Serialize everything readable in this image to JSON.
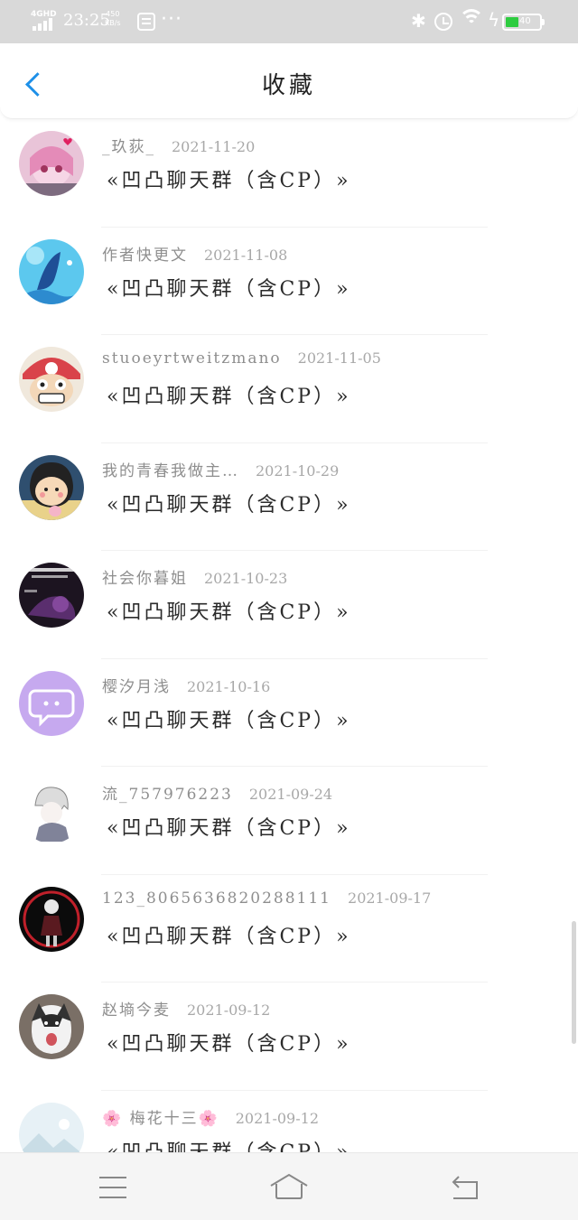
{
  "status_bar": {
    "network": "4GHD",
    "time": "23:25",
    "speed_value": "450",
    "speed_unit": "KB/s",
    "dots": "···",
    "bluetooth": "✱",
    "bolt": "ϟ",
    "battery_level": "40",
    "battery_color": "#2ecc40"
  },
  "header": {
    "back_icon": "chevron-left-icon",
    "title": "收藏",
    "accent": "#1e90e8"
  },
  "items": [
    {
      "author": "_玖荻_",
      "date": "2021-11-20",
      "group": "«凹凸聊天群（含CP）»"
    },
    {
      "author": "作者快更文",
      "date": "2021-11-08",
      "group": "«凹凸聊天群（含CP）»"
    },
    {
      "author": "stuoeyrtweitzmano",
      "date": "2021-11-05",
      "group": "«凹凸聊天群（含CP）»"
    },
    {
      "author": "我的青春我做主…",
      "date": "2021-10-29",
      "group": "«凹凸聊天群（含CP）»"
    },
    {
      "author": "社会你暮姐",
      "date": "2021-10-23",
      "group": "«凹凸聊天群（含CP）»"
    },
    {
      "author": "樱汐月浅",
      "date": "2021-10-16",
      "group": "«凹凸聊天群（含CP）»"
    },
    {
      "author": "流_757976223",
      "date": "2021-09-24",
      "group": "«凹凸聊天群（含CP）»"
    },
    {
      "author": "123_806563682028811​1",
      "date": "2021-09-17",
      "group": "«凹凸聊天群（含CP）»"
    },
    {
      "author": "赵墒今麦",
      "date": "2021-09-12",
      "group": "«凹凸聊天群（含CP）»"
    },
    {
      "author": "🌸 梅花十三🌸",
      "date": "2021-09-12",
      "group": "«凹凸聊天群（含CP）»"
    }
  ],
  "avatar_icons": [
    "anime-girl-avatar",
    "whale-avatar",
    "skull-hat-avatar",
    "cartoon-boy-avatar",
    "dark-text-avatar",
    "chat-bubble-avatar",
    "sketch-girl-avatar",
    "dark-character-avatar",
    "husky-dog-avatar",
    "default-landscape-avatar"
  ],
  "nav": {
    "menu_icon": "menu-icon",
    "home_icon": "home-icon",
    "back_icon": "back-icon"
  }
}
